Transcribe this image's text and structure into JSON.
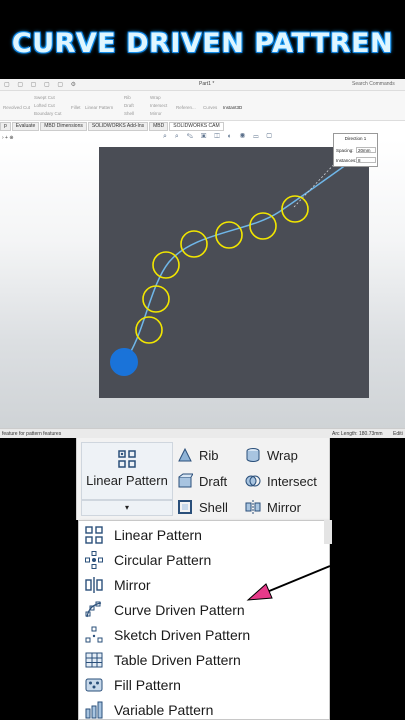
{
  "title": "CURVE DRIVEN PATTREN",
  "solidworks": {
    "document_title": "Part1 *",
    "search_placeholder": "Search Commands",
    "ribbon": {
      "revolved_cut": "Revolved Cut",
      "swept_cut": "Swept Cut",
      "lofted_cut": "Lofted Cut",
      "boundary_cut": "Boundary Cut",
      "fillet": "Fillet",
      "linear_pattern": "Linear Pattern",
      "rib": "Rib",
      "draft": "Draft",
      "shell": "Shell",
      "wrap": "Wrap",
      "intersect": "Intersect",
      "mirror": "Mirror",
      "reference": "Referen...",
      "curves": "Curves",
      "instant3d": "Instant3D"
    },
    "tabs": [
      "p",
      "Evaluate",
      "MBD Dimensions",
      "SOLIDWORKS Add-Ins",
      "MBD",
      "SOLIDWORKS CAM"
    ],
    "tree_text": "› + ⊕",
    "direction_box": {
      "header": "Direction 1",
      "spacing_label": "Spacing:",
      "spacing_value": "20mm",
      "instances_label": "Instances:",
      "instances_value": "8"
    },
    "status_left": "feature for pattern features",
    "arc_length": "Arc Length: 180.73mm",
    "status_right": "Editi"
  },
  "ribbon_zoom": {
    "linear_pattern_label": "Linear Pattern",
    "dropdown_arrow": "▾",
    "commands": {
      "rib": "Rib",
      "draft": "Draft",
      "shell": "Shell",
      "wrap": "Wrap",
      "intersect": "Intersect",
      "mirror": "Mirror"
    }
  },
  "pattern_menu": [
    {
      "label": "Linear Pattern",
      "icon": "linear-pattern-icon"
    },
    {
      "label": "Circular Pattern",
      "icon": "circular-pattern-icon"
    },
    {
      "label": "Mirror",
      "icon": "mirror-icon"
    },
    {
      "label": "Curve Driven Pattern",
      "icon": "curve-driven-pattern-icon"
    },
    {
      "label": "Sketch Driven Pattern",
      "icon": "sketch-driven-pattern-icon"
    },
    {
      "label": "Table Driven Pattern",
      "icon": "table-driven-pattern-icon"
    },
    {
      "label": "Fill Pattern",
      "icon": "fill-pattern-icon"
    },
    {
      "label": "Variable Pattern",
      "icon": "variable-pattern-icon"
    }
  ],
  "colors": {
    "title_glow": "#1ea7ff",
    "canvas_bg": "#4a4d55",
    "curve": "#6fb6e8",
    "circle": "#f2e600",
    "seed_circle": "#1a73d9",
    "arrow": "#e83a8a"
  }
}
